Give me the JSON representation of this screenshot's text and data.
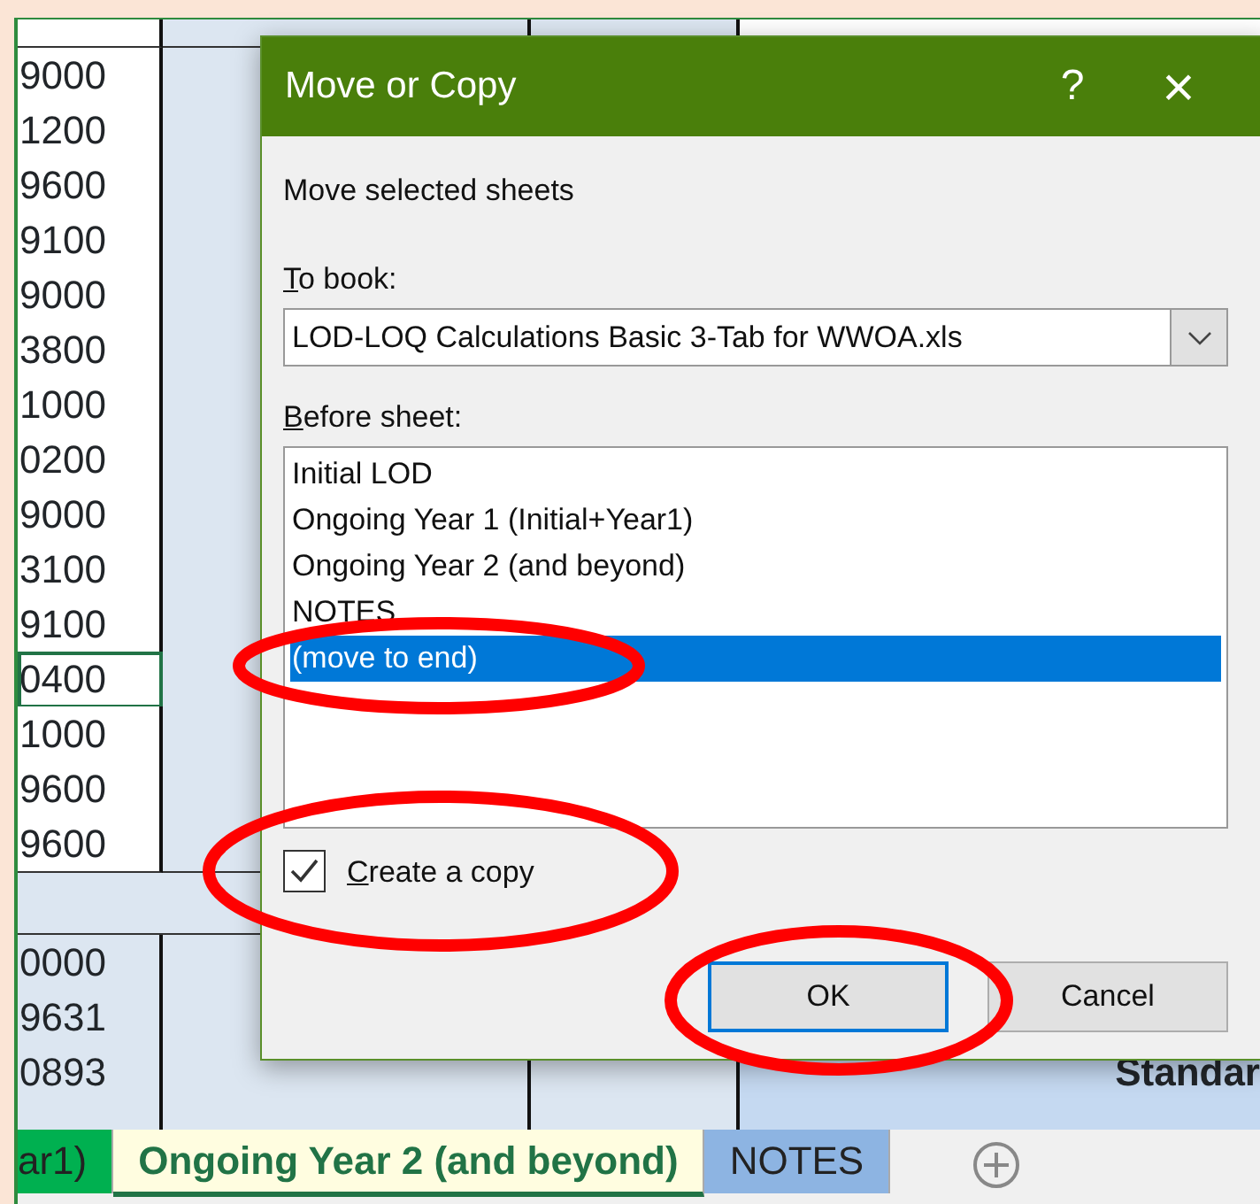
{
  "sheet": {
    "upper_values": [
      "9000",
      "1200",
      "9600",
      "9100",
      "9000",
      "3800",
      "1000",
      "0200",
      "9000",
      "3100",
      "9100",
      "0400",
      "1000",
      "9600",
      "9600"
    ],
    "lower_rows": [
      {
        "value": "0000"
      },
      {
        "value": "9631"
      },
      {
        "value": "0893",
        "label": "Standar"
      },
      {
        "value": ""
      }
    ],
    "tabs": [
      {
        "label": "ar1)",
        "selected": false,
        "color": "#00b050"
      },
      {
        "label": "Ongoing Year 2 (and beyond)",
        "selected": true,
        "color": "#fffde0"
      },
      {
        "label": "NOTES",
        "selected": false,
        "color": "#8db4e2"
      }
    ]
  },
  "dialog": {
    "title": "Move or Copy",
    "help": "?",
    "close": "×",
    "instruction": "Move selected sheets",
    "to_book": {
      "mnemonic": "T",
      "label_rest": "o book:",
      "value": "LOD-LOQ Calculations Basic 3-Tab for WWOA.xls"
    },
    "before_sheet": {
      "mnemonic": "B",
      "label_rest": "efore sheet:",
      "items": [
        {
          "label": "Initial LOD",
          "selected": false
        },
        {
          "label": "Ongoing Year 1 (Initial+Year1)",
          "selected": false
        },
        {
          "label": "Ongoing Year 2 (and beyond)",
          "selected": false
        },
        {
          "label": "NOTES",
          "selected": false
        },
        {
          "label": "(move to end)",
          "selected": true
        }
      ]
    },
    "create_copy": {
      "mnemonic": "C",
      "label_rest": "reate a copy",
      "checked": true
    },
    "buttons": [
      {
        "label": "OK",
        "default": true
      },
      {
        "label": "Cancel",
        "default": false
      }
    ]
  }
}
